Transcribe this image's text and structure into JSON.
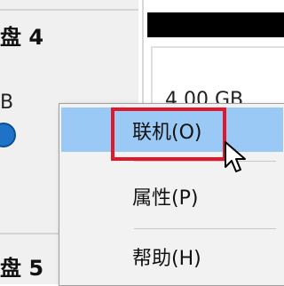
{
  "left_pane": {
    "disk4_label": "盘 4",
    "disk4_size_fragment": "B",
    "disk5_label": "盘 5"
  },
  "right_pane": {
    "partition_size_fragment": "4.00 GB"
  },
  "context_menu": {
    "items": [
      {
        "label": "联机(O)",
        "highlighted": true
      },
      {
        "label": "属性(P)"
      },
      {
        "label": "帮助(H)"
      }
    ]
  },
  "colors": {
    "highlight": "#99c9f4",
    "callout_outline": "#e0182c",
    "online_indicator": "#1e73c8"
  }
}
